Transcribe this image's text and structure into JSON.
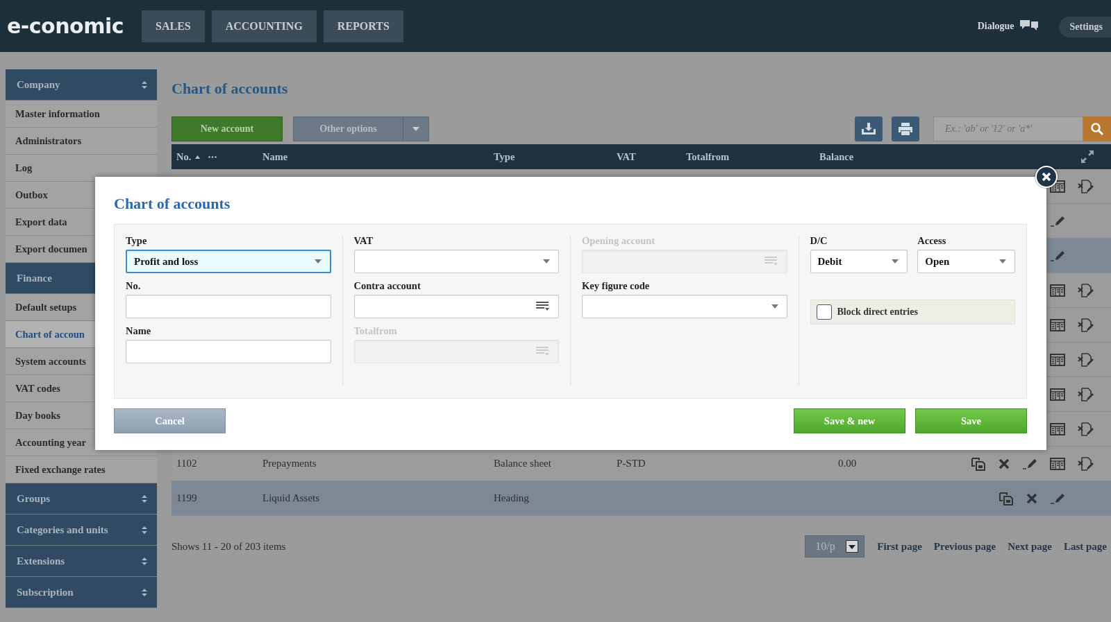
{
  "header": {
    "logo": "e-conomic",
    "nav": [
      {
        "label": "SALES",
        "selected": false
      },
      {
        "label": "ACCOUNTING",
        "selected": false
      },
      {
        "label": "REPORTS",
        "selected": false
      }
    ],
    "dialogue": "Dialogue",
    "settings": "Settings"
  },
  "sidebar": {
    "groups": [
      {
        "label": "Company",
        "items": [
          {
            "label": "Master information",
            "selected": false
          },
          {
            "label": "Administrators",
            "selected": false
          },
          {
            "label": "Log",
            "selected": false
          },
          {
            "label": "Outbox",
            "selected": false
          },
          {
            "label": "Export data",
            "selected": false
          },
          {
            "label": "Export documen",
            "selected": false
          }
        ]
      },
      {
        "label": "Finance",
        "items": [
          {
            "label": "Default setups",
            "selected": false
          },
          {
            "label": "Chart of accoun",
            "selected": true
          },
          {
            "label": "System accounts",
            "selected": false
          },
          {
            "label": "VAT codes",
            "selected": false
          },
          {
            "label": "Day books",
            "selected": false
          },
          {
            "label": "Accounting year",
            "selected": false
          },
          {
            "label": "Fixed exchange rates",
            "selected": false
          }
        ]
      },
      {
        "label": "Groups"
      },
      {
        "label": "Categories and units"
      },
      {
        "label": "Extensions"
      },
      {
        "label": "Subscription"
      }
    ]
  },
  "page": {
    "title": "Chart of accounts",
    "new_button": "New account",
    "options_button": "Other options",
    "search": {
      "placeholder": "Ex.: 'ab' or '12' or 'a*'"
    }
  },
  "table": {
    "columns": [
      {
        "label": "No.",
        "sorted": true
      },
      {
        "label": "Name",
        "sorted": false
      },
      {
        "label": "Type",
        "sorted": false
      },
      {
        "label": "VAT",
        "sorted": false
      },
      {
        "label": "Totalfrom",
        "sorted": false
      },
      {
        "label": "Balance",
        "sorted": false
      }
    ],
    "rows": [
      {
        "kind": "account",
        "selected": false,
        "actions": [
          {
            "kind": "table"
          },
          {
            "kind": "edit-doc"
          }
        ]
      },
      {
        "kind": "heading",
        "selected": false,
        "actions": [
          {
            "kind": "pencil"
          }
        ]
      },
      {
        "kind": "heading",
        "selected": true,
        "actions": [
          {
            "kind": "pencil"
          }
        ]
      },
      {
        "kind": "account",
        "selected": false,
        "actions": [
          {
            "kind": "table"
          },
          {
            "kind": "edit-doc"
          }
        ]
      },
      {
        "kind": "account",
        "selected": false,
        "actions": [
          {
            "kind": "table"
          },
          {
            "kind": "edit-doc"
          }
        ]
      },
      {
        "kind": "account",
        "selected": false,
        "actions": [
          {
            "kind": "table"
          },
          {
            "kind": "edit-doc"
          }
        ]
      },
      {
        "kind": "account",
        "selected": false,
        "actions": [
          {
            "kind": "table"
          },
          {
            "kind": "edit-doc"
          }
        ]
      },
      {
        "kind": "account",
        "selected": false,
        "actions": [
          {
            "kind": "table"
          },
          {
            "kind": "edit-doc"
          }
        ]
      },
      {
        "kind": "account",
        "selected": false,
        "no": "1102",
        "name": "Prepayments",
        "type": "Balance sheet",
        "vat": "P-STD",
        "balance": "0.00",
        "actions": [
          {
            "kind": "copy"
          },
          {
            "kind": "delete"
          },
          {
            "kind": "pencil"
          },
          {
            "kind": "table"
          },
          {
            "kind": "edit-doc"
          }
        ]
      },
      {
        "kind": "heading",
        "selected": true,
        "no": "1199",
        "name": "Liquid Assets",
        "type": "Heading",
        "actions": [
          {
            "kind": "copy"
          },
          {
            "kind": "delete"
          },
          {
            "kind": "pencil"
          }
        ]
      }
    ]
  },
  "footer": {
    "summary": "Shows 11 - 20 of 203 items",
    "page_size": "10/p",
    "pages": [
      "First page",
      "Previous page",
      "Next page",
      "Last page"
    ]
  },
  "dialog": {
    "title": "Chart of accounts",
    "columns": [
      {
        "rows": [
          [
            {
              "kind": "select",
              "label": "Type",
              "value": "Profit and loss",
              "focused": true,
              "disabled": false
            }
          ],
          [
            {
              "kind": "text",
              "label": "No.",
              "focused": false,
              "disabled": false
            }
          ],
          [
            {
              "kind": "text",
              "label": "Name",
              "focused": false,
              "disabled": false
            }
          ]
        ]
      },
      {
        "rows": [
          [
            {
              "kind": "select",
              "label": "VAT",
              "focused": false,
              "disabled": false
            }
          ],
          [
            {
              "kind": "lookup",
              "label": "Contra account",
              "focused": false,
              "disabled": false
            }
          ],
          [
            {
              "kind": "lookup",
              "label": "Totalfrom",
              "focused": false,
              "disabled": true
            }
          ]
        ]
      },
      {
        "rows": [
          [
            {
              "kind": "lookup",
              "label": "Opening account",
              "focused": false,
              "disabled": true
            }
          ],
          [
            {
              "kind": "select",
              "label": "Key figure code",
              "focused": false,
              "disabled": false
            }
          ]
        ]
      },
      {
        "rows": [
          [
            {
              "kind": "select",
              "label": "D/C",
              "value": "Debit",
              "focused": false,
              "disabled": false
            },
            {
              "kind": "select",
              "label": "Access",
              "value": "Open",
              "focused": false,
              "disabled": false
            }
          ],
          [
            {
              "kind": "checkbox",
              "label": "Block direct entries",
              "checked": false
            }
          ]
        ]
      }
    ],
    "buttons": [
      {
        "label": "Cancel",
        "kind": "secondary"
      },
      {
        "label": "Save & new",
        "kind": "primary"
      },
      {
        "label": "Save",
        "kind": "primary"
      }
    ]
  }
}
